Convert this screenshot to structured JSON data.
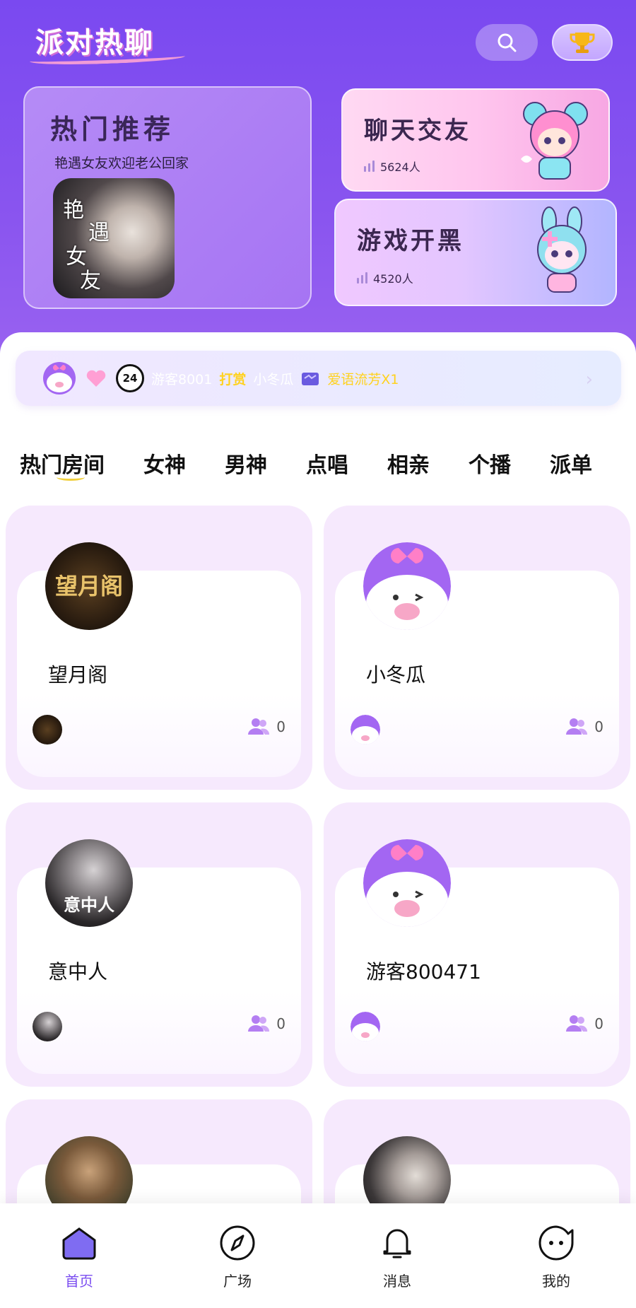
{
  "header": {
    "logo_text": "派对热聊"
  },
  "featured": {
    "hot": {
      "title": "热门推荐",
      "subtitle": "艳遇女友欢迎老公回家",
      "thumb_calligraphy": [
        "艳",
        "遇",
        "女",
        "友"
      ]
    },
    "chat": {
      "title": "聊天交友",
      "count": "5624人"
    },
    "game": {
      "title": "游戏开黑",
      "count": "4520人"
    }
  },
  "ticker": {
    "user": "游客8001",
    "verb": "打赏",
    "target": "小冬瓜",
    "gift": "爱语流芳X1",
    "badge_24": "24"
  },
  "tabs": [
    "热门房间",
    "女神",
    "男神",
    "点唱",
    "相亲",
    "个播",
    "派单"
  ],
  "rooms": [
    {
      "name": "望月阁",
      "count": "0",
      "avatar_text": "望月阁"
    },
    {
      "name": "小冬瓜",
      "count": "0"
    },
    {
      "name": "意中人",
      "count": "0",
      "avatar_text": "意中人"
    },
    {
      "name": "游客800471",
      "count": "0"
    }
  ],
  "bottom_nav": [
    {
      "label": "首页",
      "icon": "home-icon",
      "active": true
    },
    {
      "label": "广场",
      "icon": "compass-icon",
      "active": false
    },
    {
      "label": "消息",
      "icon": "bell-icon",
      "active": false
    },
    {
      "label": "我的",
      "icon": "face-icon",
      "active": false
    }
  ],
  "colors": {
    "primary": "#7a49f0",
    "accent_yellow": "#ffd21f",
    "card_bg": "#f6e9fd"
  }
}
